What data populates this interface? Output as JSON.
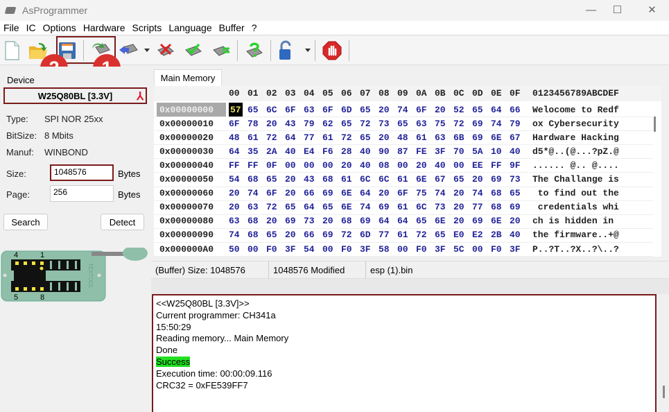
{
  "window": {
    "title": "AsProgrammer",
    "minimize": "—",
    "maximize": "☐",
    "close": "✕"
  },
  "menu": [
    "File",
    "IC",
    "Options",
    "Hardware",
    "Scripts",
    "Language",
    "Buffer",
    "?"
  ],
  "toolbar": {
    "buttons": [
      "new-file",
      "open-file",
      "save-file",
      "read-chip",
      "write-chip",
      "erase-chip",
      "verify-chip",
      "compare-chip",
      "blank-check",
      "unlock",
      "stop"
    ],
    "badges": [
      "2",
      "1"
    ]
  },
  "device": {
    "group_label": "Device",
    "name": "W25Q80BL [3.3V]",
    "type_label": "Type:",
    "type_value": "SPI NOR  25xx",
    "bitsize_label": "BitSize:",
    "bitsize_value": "8 Mbits",
    "manuf_label": "Manuf:",
    "manuf_value": "WINBOND",
    "size_label": "Size:",
    "size_value": "1048576",
    "size_unit": "Bytes",
    "page_label": "Page:",
    "page_value": "256",
    "page_unit": "Bytes",
    "search_label": "Search",
    "detect_label": "Detect"
  },
  "socket": {
    "pin_labels": [
      "4",
      "1",
      "5",
      "8"
    ],
    "brand": "TEXTOOL"
  },
  "hex": {
    "tab": "Main Memory",
    "columns": [
      "00",
      "01",
      "02",
      "03",
      "04",
      "05",
      "06",
      "07",
      "08",
      "09",
      "0A",
      "0B",
      "0C",
      "0D",
      "0E",
      "0F"
    ],
    "ascii_header": "0123456789ABCDEF",
    "rows": [
      {
        "addr": "0x00000000",
        "bytes": [
          "57",
          "65",
          "6C",
          "6F",
          "63",
          "6F",
          "6D",
          "65",
          "20",
          "74",
          "6F",
          "20",
          "52",
          "65",
          "64",
          "66"
        ],
        "ascii": "Welocome to Redf"
      },
      {
        "addr": "0x00000010",
        "bytes": [
          "6F",
          "78",
          "20",
          "43",
          "79",
          "62",
          "65",
          "72",
          "73",
          "65",
          "63",
          "75",
          "72",
          "69",
          "74",
          "79"
        ],
        "ascii": "ox Cybersecurity"
      },
      {
        "addr": "0x00000020",
        "bytes": [
          "48",
          "61",
          "72",
          "64",
          "77",
          "61",
          "72",
          "65",
          "20",
          "48",
          "61",
          "63",
          "6B",
          "69",
          "6E",
          "67"
        ],
        "ascii": "Hardware Hacking"
      },
      {
        "addr": "0x00000030",
        "bytes": [
          "64",
          "35",
          "2A",
          "40",
          "E4",
          "F6",
          "28",
          "40",
          "90",
          "87",
          "FE",
          "3F",
          "70",
          "5A",
          "10",
          "40"
        ],
        "ascii": "d5*@..(@...?pZ.@"
      },
      {
        "addr": "0x00000040",
        "bytes": [
          "FF",
          "FF",
          "0F",
          "00",
          "00",
          "00",
          "20",
          "40",
          "08",
          "00",
          "20",
          "40",
          "00",
          "EE",
          "FF",
          "9F"
        ],
        "ascii": "...... @.. @...."
      },
      {
        "addr": "0x00000050",
        "bytes": [
          "54",
          "68",
          "65",
          "20",
          "43",
          "68",
          "61",
          "6C",
          "6C",
          "61",
          "6E",
          "67",
          "65",
          "20",
          "69",
          "73"
        ],
        "ascii": "The Challange is"
      },
      {
        "addr": "0x00000060",
        "bytes": [
          "20",
          "74",
          "6F",
          "20",
          "66",
          "69",
          "6E",
          "64",
          "20",
          "6F",
          "75",
          "74",
          "20",
          "74",
          "68",
          "65"
        ],
        "ascii": " to find out the"
      },
      {
        "addr": "0x00000070",
        "bytes": [
          "20",
          "63",
          "72",
          "65",
          "64",
          "65",
          "6E",
          "74",
          "69",
          "61",
          "6C",
          "73",
          "20",
          "77",
          "68",
          "69"
        ],
        "ascii": " credentials whi"
      },
      {
        "addr": "0x00000080",
        "bytes": [
          "63",
          "68",
          "20",
          "69",
          "73",
          "20",
          "68",
          "69",
          "64",
          "64",
          "65",
          "6E",
          "20",
          "69",
          "6E",
          "20"
        ],
        "ascii": "ch is hidden in "
      },
      {
        "addr": "0x00000090",
        "bytes": [
          "74",
          "68",
          "65",
          "20",
          "66",
          "69",
          "72",
          "6D",
          "77",
          "61",
          "72",
          "65",
          "E0",
          "E2",
          "2B",
          "40"
        ],
        "ascii": "the firmware..+@"
      },
      {
        "addr": "0x000000A0",
        "bytes": [
          "50",
          "00",
          "F0",
          "3F",
          "54",
          "00",
          "F0",
          "3F",
          "58",
          "00",
          "F0",
          "3F",
          "5C",
          "00",
          "F0",
          "3F"
        ],
        "ascii": "P..?T..?X..?\\..?"
      }
    ]
  },
  "status": {
    "buffer_size": "(Buffer) Size: 1048576",
    "modified": "1048576 Modified",
    "file": "esp (1).bin"
  },
  "log": [
    "<<W25Q80BL [3.3V]>>",
    "Current programmer: CH341a",
    "15:50:29",
    "Reading memory... Main Memory",
    "Done",
    "Success",
    "Execution time: 00:00:09.116",
    "CRC32 = 0xFE539FF7"
  ],
  "colors": {
    "accent_border": "#7a1a1a",
    "success": "#22e022",
    "hex_text": "#22229a",
    "badge": "#d9312e"
  }
}
